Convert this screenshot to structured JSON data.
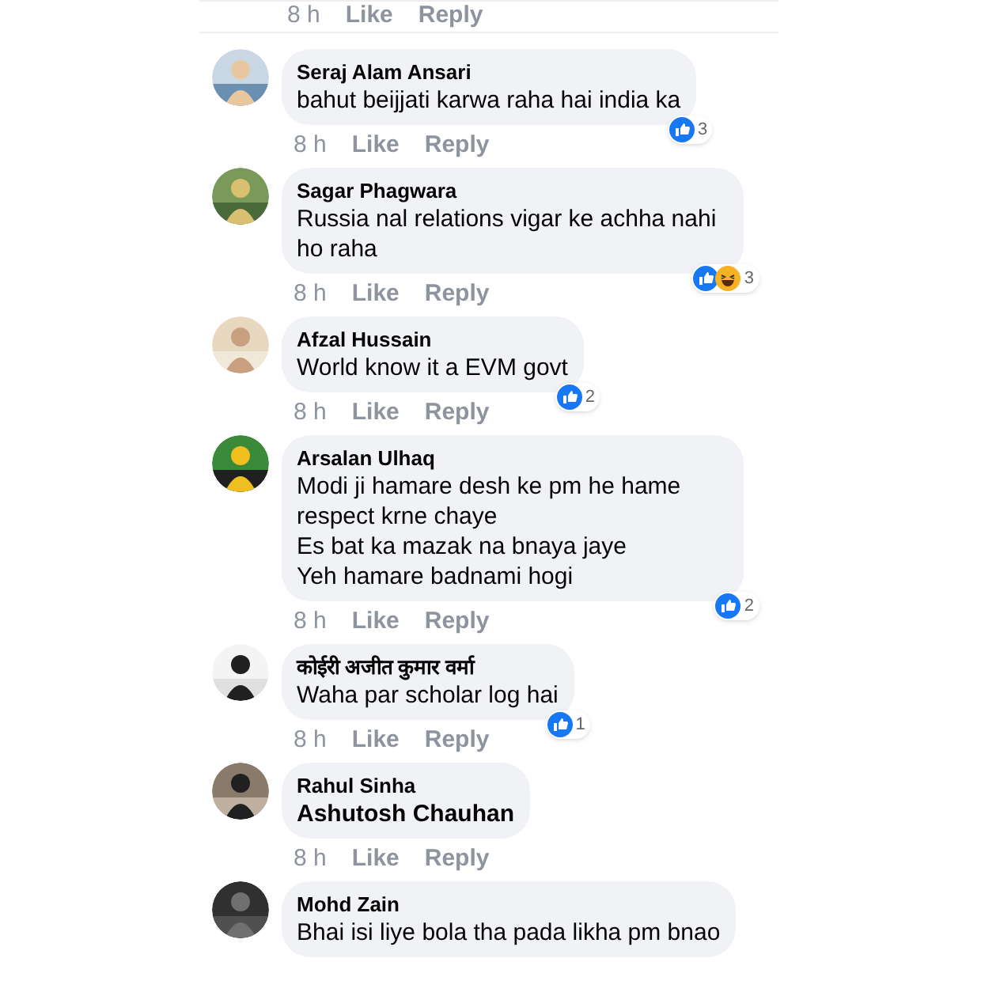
{
  "top_actions": {
    "time": "8 h",
    "like": "Like",
    "reply": "Reply"
  },
  "comments": [
    {
      "name": "Seraj Alam Ansari",
      "lines": [
        "bahut beijjati karwa raha hai india ka"
      ],
      "mention": false,
      "time": "8 h",
      "like": "Like",
      "reply": "Reply",
      "reactions": [
        {
          "kind": "like"
        }
      ],
      "count": "3"
    },
    {
      "name": "Sagar Phagwara",
      "lines": [
        "Russia nal relations  vigar ke achha nahi ho raha"
      ],
      "mention": false,
      "time": "8 h",
      "like": "Like",
      "reply": "Reply",
      "reactions": [
        {
          "kind": "like"
        },
        {
          "kind": "haha"
        }
      ],
      "count": "3"
    },
    {
      "name": "Afzal Hussain",
      "lines": [
        "World know it a EVM govt"
      ],
      "mention": false,
      "time": "8 h",
      "like": "Like",
      "reply": "Reply",
      "reactions": [
        {
          "kind": "like"
        }
      ],
      "count": "2"
    },
    {
      "name": "Arsalan Ulhaq",
      "lines": [
        "Modi ji hamare desh ke pm he hame respect krne chaye",
        "Es bat ka mazak na bnaya jaye",
        "Yeh hamare badnami hogi"
      ],
      "mention": false,
      "time": "8 h",
      "like": "Like",
      "reply": "Reply",
      "reactions": [
        {
          "kind": "like"
        }
      ],
      "count": "2"
    },
    {
      "name": "कोईरी अजीत कुमार वर्मा",
      "lines": [
        "Waha par scholar log hai"
      ],
      "mention": false,
      "time": "8 h",
      "like": "Like",
      "reply": "Reply",
      "reactions": [
        {
          "kind": "like"
        }
      ],
      "count": "1"
    },
    {
      "name": "Rahul Sinha",
      "lines": [
        "Ashutosh Chauhan"
      ],
      "mention": true,
      "time": "8 h",
      "like": "Like",
      "reply": "Reply"
    },
    {
      "name": "Mohd Zain",
      "lines": [
        "Bhai isi liye bola tha pada likha pm bnao"
      ],
      "mention": false
    }
  ]
}
